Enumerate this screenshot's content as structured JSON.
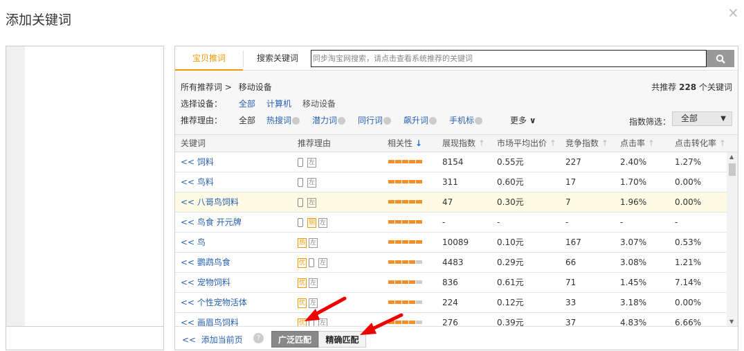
{
  "dialog": {
    "title": "添加关键词",
    "close": "×"
  },
  "tabs": [
    {
      "label": "宝贝推词",
      "active": true
    },
    {
      "label": "搜索关键词",
      "active": false
    }
  ],
  "search": {
    "placeholder": "同步淘宝网搜索，请点击查看系统推荐的关键词",
    "value": "",
    "icon": "search-icon"
  },
  "breadcrumb": {
    "root": "所有推荐词 >",
    "current": "移动设备"
  },
  "total": {
    "prefix": "共推荐",
    "count": "228",
    "suffix": "个关键词"
  },
  "device": {
    "label": "选择设备：",
    "options": [
      "全部",
      "计算机",
      "移动设备"
    ]
  },
  "reason": {
    "label": "推荐理由：",
    "options": [
      "全部",
      "热搜词",
      "潜力词",
      "同行词",
      "飙升词",
      "手机标"
    ],
    "more": "更多"
  },
  "index_filter": {
    "label": "指数筛选：",
    "value": "全部"
  },
  "columns": [
    "关键词",
    "推荐理由",
    "相关性",
    "展现指数",
    "市场平均出价",
    "竞争指数",
    "点击率",
    "点击转化率"
  ],
  "rows": [
    {
      "keyword": "<< 饲料",
      "tags": [
        "phone",
        "左"
      ],
      "relevance": 5,
      "show": "8154",
      "price": "0.55元",
      "comp": "227",
      "ctr": "2.40%",
      "cvr": "1.27%"
    },
    {
      "keyword": "<< 鸟料",
      "tags": [
        "phone",
        "左"
      ],
      "relevance": 5,
      "show": "311",
      "price": "0.60元",
      "comp": "17",
      "ctr": "1.70%",
      "cvr": "0.00%"
    },
    {
      "keyword": "<< 八哥鸟饲料",
      "tags": [
        "phone",
        "左"
      ],
      "relevance": 5,
      "show": "47",
      "price": "0.30元",
      "comp": "7",
      "ctr": "1.96%",
      "cvr": "0.00%",
      "highlight": true
    },
    {
      "keyword": "<< 鸟食 开元牌",
      "tags": [
        "phone",
        "铜",
        "左"
      ],
      "relevance": 5,
      "show": "-",
      "price": "-",
      "comp": "-",
      "ctr": "-",
      "cvr": "-"
    },
    {
      "keyword": "<< 鸟",
      "tags": [
        "热",
        "左"
      ],
      "relevance": 5,
      "show": "10089",
      "price": "0.10元",
      "comp": "167",
      "ctr": "3.07%",
      "cvr": "0.53%"
    },
    {
      "keyword": "<< 鹦鹉鸟食",
      "tags": [
        "优",
        "phone",
        "左"
      ],
      "relevance": 4,
      "show": "4483",
      "price": "0.29元",
      "comp": "66",
      "ctr": "3.08%",
      "cvr": "1.21%"
    },
    {
      "keyword": "<< 宠物饲料",
      "tags": [
        "优",
        "左"
      ],
      "relevance": 4,
      "show": "836",
      "price": "0.61元",
      "comp": "71",
      "ctr": "1.45%",
      "cvr": "7.14%"
    },
    {
      "keyword": "<< 个性宠物活体",
      "tags": [
        "优",
        "左"
      ],
      "relevance": 4,
      "show": "224",
      "price": "0.12元",
      "comp": "33",
      "ctr": "3.18%",
      "cvr": "0.00%"
    },
    {
      "keyword": "<< 画眉鸟饲料",
      "tags": [
        "优",
        "phone",
        "左"
      ],
      "relevance": 4,
      "show": "276",
      "price": "0.39元",
      "comp": "37",
      "ctr": "4.83%",
      "cvr": "6.66%"
    }
  ],
  "footer": {
    "add_page": "<<  添加当前页",
    "help": "?",
    "broad": "广泛匹配",
    "exact": "精确匹配"
  },
  "colors": {
    "accent": "#f39800",
    "link": "#2962b0",
    "annotation_arrow": "#e00000"
  }
}
